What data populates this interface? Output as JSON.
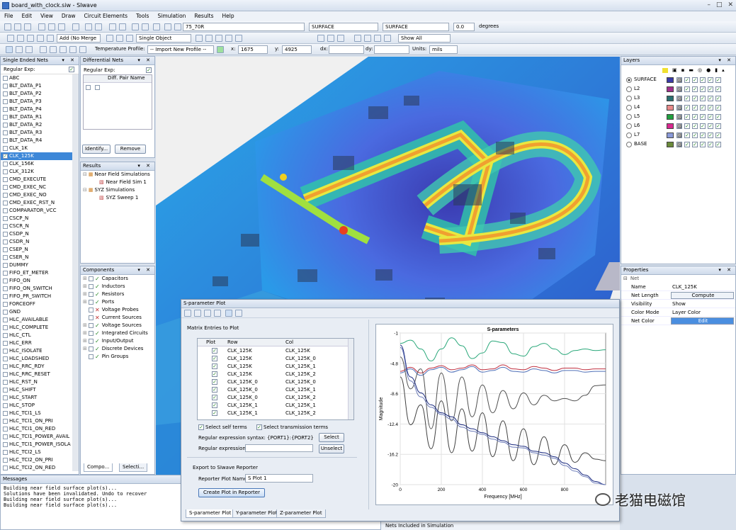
{
  "window": {
    "title": "board_with_clock.siw - SIwave"
  },
  "menu": [
    "File",
    "Edit",
    "View",
    "Draw",
    "Circuit Elements",
    "Tools",
    "Simulation",
    "Results",
    "Help"
  ],
  "toolbar1": {
    "stackup": "75_70R",
    "surface_a": "SURFACE",
    "surface_b": "SURFACE",
    "angle": "0.0",
    "angle_unit": "degrees"
  },
  "toolbar2": {
    "add_mode": "Add (No Merge",
    "select_mode": "Single Object",
    "show": "Show All"
  },
  "toolbar3": {
    "temp_label": "Temperature Profile:",
    "temp_value": "-- Import New Profile --",
    "x_label": "x:",
    "x_value": "1675",
    "y_label": "y:",
    "y_value": "4925",
    "dx_label": "dx:",
    "dy_label": "dy:",
    "units_label": "Units:",
    "units_value": "mils"
  },
  "single_nets": {
    "title": "Single Ended Nets",
    "regexp": "Regular Exp:",
    "items": [
      "ABC",
      "BLT_DATA_P1",
      "BLT_DATA_P2",
      "BLT_DATA_P3",
      "BLT_DATA_P4",
      "BLT_DATA_R1",
      "BLT_DATA_R2",
      "BLT_DATA_R3",
      "BLT_DATA_R4",
      "CLK_1K",
      "CLK_125K",
      "CLK_156K",
      "CLK_312K",
      "CMD_EXECUTE",
      "CMD_EXEC_NC",
      "CMD_EXEC_NO",
      "CMD_EXEC_RST_N",
      "COMPARATOR_VCC",
      "CSCP_N",
      "CSCR_N",
      "CSDP_N",
      "CSDR_N",
      "CSEP_N",
      "CSER_N",
      "DUMMY",
      "FIFO_ET_METER",
      "FIFO_ON",
      "FIFO_ON_SWITCH",
      "FIFO_PR_SWITCH",
      "FORCEOFF",
      "GND",
      "HLC_AVAILABLE",
      "HLC_COMPLETE",
      "HLC_CTL",
      "HLC_ERR",
      "HLC_ISOLATE",
      "HLC_LOADSHED",
      "HLC_RRC_RDY",
      "HLC_RRC_RESET",
      "HLC_RST_N",
      "HLC_SHIFT",
      "HLC_START",
      "HLC_STOP",
      "HLC_TCI1_LS",
      "HLC_TCI1_ON_PRI",
      "HLC_TCI1_ON_RED",
      "HLC_TCI1_POWER_AVAIL",
      "HLC_TCI1_POWER_ISOLA",
      "HLC_TCI2_LS",
      "HLC_TCI2_ON_PRI",
      "HLC_TCI2_ON_RED"
    ],
    "selected_index": 10
  },
  "diff_nets": {
    "title": "Differential Nets",
    "regexp": "Regular Exp:",
    "col": "Diff. Pair Name",
    "identify": "Identify...",
    "remove": "Remove"
  },
  "results": {
    "title": "Results",
    "items": [
      "Near Field Simulations",
      "Near Field Sim 1",
      "SYZ Simulations",
      "SYZ Sweep 1"
    ]
  },
  "components": {
    "title": "Components",
    "items": [
      "Capacitors",
      "Inductors",
      "Resistors",
      "Ports",
      "Voltage Probes",
      "Current Sources",
      "Voltage Sources",
      "Integrated Circuits",
      "Input/Output",
      "Discrete Devices",
      "Pin Groups"
    ],
    "tabs": [
      "Compo...",
      "Selecti..."
    ]
  },
  "layers": {
    "title": "Layers",
    "items": [
      {
        "name": "SURFACE",
        "color": "#3a3aa8"
      },
      {
        "name": "L2",
        "color": "#a0308c"
      },
      {
        "name": "L3",
        "color": "#2a7070"
      },
      {
        "name": "L4",
        "color": "#e88a8a"
      },
      {
        "name": "L5",
        "color": "#20a040"
      },
      {
        "name": "L6",
        "color": "#d82890"
      },
      {
        "name": "L7",
        "color": "#8a9ad8"
      },
      {
        "name": "BASE",
        "color": "#6a8a3a"
      }
    ]
  },
  "properties": {
    "title": "Properties",
    "section": "Net",
    "rows": [
      {
        "k": "Name",
        "v": "CLK_125K"
      },
      {
        "k": "Net Length",
        "v": "Compute"
      },
      {
        "k": "Visibility",
        "v": "Show"
      },
      {
        "k": "Color Mode",
        "v": "Layer Color"
      },
      {
        "k": "Net Color",
        "v": "Edit"
      }
    ]
  },
  "splot": {
    "title": "S-parameter Plot",
    "matrix_label": "Matrix Entries to Plot",
    "cols": [
      "Plot",
      "Row",
      "Col"
    ],
    "rows": [
      [
        "CLK_125K",
        "CLK_125K"
      ],
      [
        "CLK_125K",
        "CLK_125K_0"
      ],
      [
        "CLK_125K",
        "CLK_125K_1"
      ],
      [
        "CLK_125K",
        "CLK_125K_2"
      ],
      [
        "CLK_125K_0",
        "CLK_125K_0"
      ],
      [
        "CLK_125K_0",
        "CLK_125K_1"
      ],
      [
        "CLK_125K_0",
        "CLK_125K_2"
      ],
      [
        "CLK_125K_1",
        "CLK_125K_1"
      ],
      [
        "CLK_125K_1",
        "CLK_125K_2"
      ]
    ],
    "self_terms": "Select self terms",
    "trans_terms": "Select transmission terms",
    "syntax_label": "Regular expression syntax: {PORT1}:{PORT2}",
    "select": "Select",
    "regex_label": "Regular expression:",
    "unselect": "Unselect",
    "export_label": "Export to SIwave Reporter",
    "reporter_label": "Reporter Plot Name:",
    "reporter_value": "S Plot 1",
    "create_btn": "Create Plot in Reporter",
    "tabs": [
      "S-parameter Plot",
      "Y-parameter Plot",
      "Z-parameter Plot"
    ]
  },
  "messages": {
    "title": "Messages",
    "lines": [
      "Building near field surface plot(s)...",
      "Solutions have been invalidated. Undo to recover",
      "Building near field surface plot(s)...",
      "Building near field surface plot(s)..."
    ]
  },
  "status": {
    "nets_label": "Nets Included in Simulation"
  },
  "watermark": "老猫电磁馆",
  "chart_data": {
    "type": "line",
    "title": "S-parameters",
    "xlabel": "Frequency [MHz]",
    "ylabel": "Magnitude",
    "xlim": [
      0,
      1000
    ],
    "ylim": [
      -20,
      -1
    ],
    "x_ticks": [
      0,
      200,
      400,
      600,
      800
    ],
    "y_ticks": [
      -1,
      -4.8,
      -8.6,
      -12.4,
      -16.2,
      -20
    ],
    "x": [
      0,
      50,
      100,
      150,
      200,
      250,
      300,
      350,
      400,
      450,
      500,
      550,
      600,
      650,
      700,
      750,
      800,
      850,
      900,
      950,
      1000
    ],
    "series": [
      {
        "color": "#2aa87a",
        "values": [
          -2.3,
          -1.9,
          -3.0,
          -4.5,
          -3.0,
          -1.6,
          -2.6,
          -4.2,
          -3.5,
          -2.0,
          -2.2,
          -3.6,
          -3.9,
          -2.7,
          -2.3,
          -3.0,
          -3.7,
          -3.2,
          -3.0,
          -3.2,
          -3.1
        ]
      },
      {
        "color": "#c03040",
        "values": [
          -5.8,
          -5.3,
          -6.0,
          -5.4,
          -5.1,
          -5.6,
          -5.4,
          -5.0,
          -5.6,
          -5.5,
          -5.0,
          -5.5,
          -5.6,
          -5.2,
          -5.4,
          -5.7,
          -5.4,
          -5.4,
          -5.6,
          -5.5,
          -5.5
        ]
      },
      {
        "color": "#5070b8",
        "values": [
          -6.0,
          -5.5,
          -6.3,
          -5.6,
          -5.3,
          -5.9,
          -5.6,
          -5.2,
          -5.9,
          -5.7,
          -5.3,
          -5.8,
          -5.9,
          -5.5,
          -5.7,
          -6.0,
          -5.7,
          -5.7,
          -5.9,
          -5.8,
          -5.8
        ]
      },
      {
        "color": "#505050",
        "values": [
          -4.0,
          -8.0,
          -5.5,
          -13.0,
          -6.0,
          -12.0,
          -6.5,
          -11.5,
          -7.5,
          -11.0,
          -8.2,
          -10.5,
          -8.5,
          -10.0,
          -8.8,
          -9.5,
          -9.2,
          -9.5,
          -8.8,
          -7.6,
          -7.5
        ]
      },
      {
        "color": "#404040",
        "values": [
          -6.5,
          -12.5,
          -10.0,
          -15.5,
          -9.5,
          -16.0,
          -10.5,
          -15.8,
          -11.0,
          -16.5,
          -12.0,
          -17.0,
          -13.0,
          -17.5,
          -14.0,
          -17.5,
          -15.0,
          -17.2,
          -16.0,
          -16.8,
          -17.0
        ]
      },
      {
        "color": "#1a2a80",
        "values": [
          -2.5,
          -6.5,
          -8.5,
          -10.0,
          -11.0,
          -11.5,
          -12.5,
          -13.0,
          -13.5,
          -14.0,
          -14.5,
          -15.0,
          -15.2,
          -15.8,
          -16.0,
          -16.5,
          -17.3,
          -18.0,
          -18.8,
          -19.6,
          -20.0
        ]
      },
      {
        "color": "#6a7ab8",
        "values": [
          -2.8,
          -7.0,
          -9.0,
          -10.3,
          -11.2,
          -11.8,
          -12.8,
          -13.3,
          -13.7,
          -14.3,
          -14.7,
          -15.3,
          -15.4,
          -16.0,
          -16.3,
          -16.7,
          -17.6,
          -18.3,
          -19.0,
          -19.8,
          -20.0
        ]
      }
    ]
  }
}
